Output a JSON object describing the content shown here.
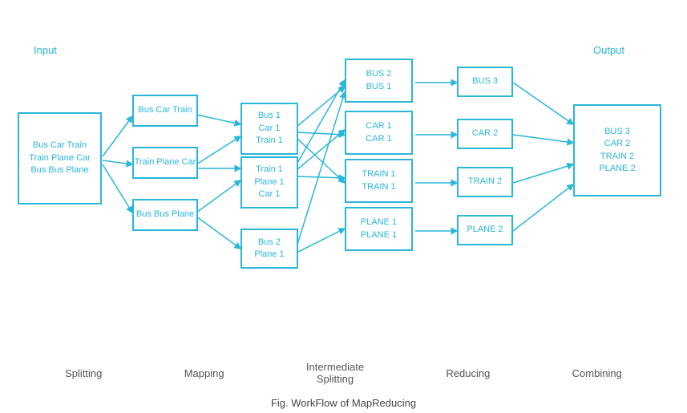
{
  "title": "Fig. WorkFlow of MapReducing",
  "labels": {
    "input": "Input",
    "output": "Output",
    "splitting": "Splitting",
    "mapping": "Mapping",
    "intermediate_splitting": "Intermediate\nSplitting",
    "reducing": "Reducing",
    "combining": "Combining"
  },
  "nodes": {
    "input": "Bus Car Train\nTrain Plane Car\nBus Bus Plane",
    "map1": "Bus Car Train",
    "map2": "Train Plane Car",
    "map3": "Bus Bus Plane",
    "split1": "Bus 1\nCar 1\nTrain 1",
    "split2": "Train 1\nPlane 1\nCar 1",
    "split3": "Bus 2\nPlane 1",
    "inter1": "BUS 2\nBUS 1",
    "inter2": "CAR 1\nCAR 1",
    "inter3": "TRAIN 1\nTRAIN 1",
    "inter4": "PLANE 1\nPLANE 1",
    "red1": "BUS 3",
    "red2": "CAR 2",
    "red3": "TRAIN 2",
    "red4": "PLANE 2",
    "output": "BUS 3\nCAR 2\nTRAIN 2\nPLANE 2"
  },
  "colors": {
    "accent": "#29b6d8"
  }
}
